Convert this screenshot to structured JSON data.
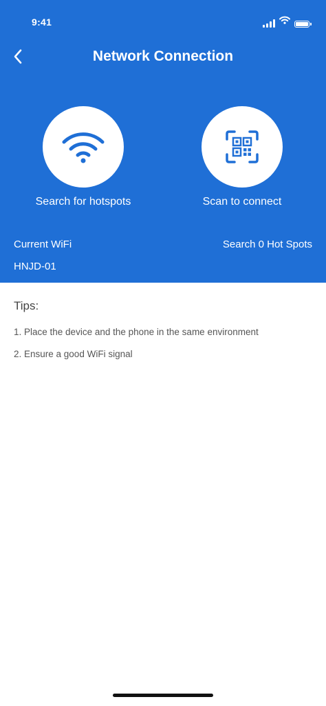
{
  "status_bar": {
    "time": "9:41"
  },
  "nav": {
    "title": "Network Connection",
    "back_icon": "chevron-left-icon"
  },
  "actions": {
    "search": {
      "label": "Search for hotspots",
      "icon": "wifi-icon"
    },
    "scan": {
      "label": "Scan to connect",
      "icon": "qr-scan-icon"
    }
  },
  "wifi": {
    "current_label": "Current WiFi",
    "current_name": "HNJD-01",
    "search_hotspots_text": "Search 0 Hot Spots"
  },
  "tips": {
    "title": "Tips:",
    "items": [
      "1. Place the device and the phone in the same environment",
      "2. Ensure a good WiFi signal"
    ]
  },
  "colors": {
    "primary": "#1f6fd6",
    "background": "#ffffff",
    "tip_text": "#555555"
  }
}
